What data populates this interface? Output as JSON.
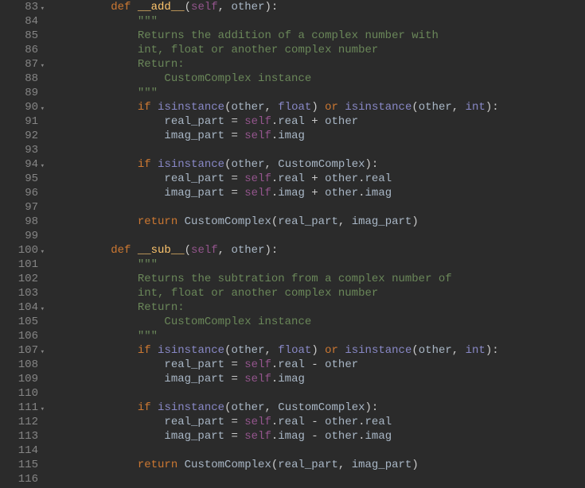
{
  "gutter": {
    "start": 83,
    "end": 116,
    "fold_lines": [
      83,
      87,
      90,
      94,
      100,
      104,
      107,
      111
    ]
  },
  "code": {
    "lines": [
      {
        "t": "def1",
        "indent": 8,
        "name": "__add__",
        "params": "(self, other):"
      },
      {
        "t": "doc",
        "indent": 12,
        "text": "\"\"\""
      },
      {
        "t": "doc",
        "indent": 12,
        "text": "Returns the addition of a complex number with"
      },
      {
        "t": "doc",
        "indent": 12,
        "text": "int, float or another complex number"
      },
      {
        "t": "doc",
        "indent": 12,
        "text": "Return:"
      },
      {
        "t": "doc",
        "indent": 12,
        "text": "    CustomComplex instance"
      },
      {
        "t": "doc",
        "indent": 12,
        "text": "\"\"\""
      },
      {
        "t": "if1",
        "indent": 12
      },
      {
        "t": "assign",
        "indent": 16,
        "lhs": "real_part",
        "rhs_self": "real",
        "op": "+",
        "tail": "other"
      },
      {
        "t": "assign",
        "indent": 16,
        "lhs": "imag_part",
        "rhs_self": "imag",
        "op": "",
        "tail": ""
      },
      {
        "t": "blank"
      },
      {
        "t": "if2",
        "indent": 12
      },
      {
        "t": "assign",
        "indent": 16,
        "lhs": "real_part",
        "rhs_self": "real",
        "op": "+",
        "tail": "other.real"
      },
      {
        "t": "assign",
        "indent": 16,
        "lhs": "imag_part",
        "rhs_self": "imag",
        "op": "+",
        "tail": "other.imag"
      },
      {
        "t": "blank"
      },
      {
        "t": "ret",
        "indent": 12
      },
      {
        "t": "blank"
      },
      {
        "t": "def1",
        "indent": 8,
        "name": "__sub__",
        "params": "(self, other):"
      },
      {
        "t": "doc",
        "indent": 12,
        "text": "\"\"\""
      },
      {
        "t": "doc",
        "indent": 12,
        "text": "Returns the subtration from a complex number of"
      },
      {
        "t": "doc",
        "indent": 12,
        "text": "int, float or another complex number"
      },
      {
        "t": "doc",
        "indent": 12,
        "text": "Return:"
      },
      {
        "t": "doc",
        "indent": 12,
        "text": "    CustomComplex instance"
      },
      {
        "t": "doc",
        "indent": 12,
        "text": "\"\"\""
      },
      {
        "t": "if1",
        "indent": 12
      },
      {
        "t": "assign",
        "indent": 16,
        "lhs": "real_part",
        "rhs_self": "real",
        "op": "-",
        "tail": "other"
      },
      {
        "t": "assign",
        "indent": 16,
        "lhs": "imag_part",
        "rhs_self": "imag",
        "op": "",
        "tail": ""
      },
      {
        "t": "blank"
      },
      {
        "t": "if2",
        "indent": 12
      },
      {
        "t": "assign",
        "indent": 16,
        "lhs": "real_part",
        "rhs_self": "real",
        "op": "-",
        "tail": "other.real"
      },
      {
        "t": "assign",
        "indent": 16,
        "lhs": "imag_part",
        "rhs_self": "imag",
        "op": "-",
        "tail": "other.imag"
      },
      {
        "t": "blank"
      },
      {
        "t": "ret",
        "indent": 12
      },
      {
        "t": "blank"
      }
    ]
  },
  "tokens": {
    "def": "def",
    "if": "if",
    "or": "or",
    "return": "return",
    "isinstance": "isinstance",
    "float": "float",
    "int": "int",
    "self": "self",
    "CustomComplex": "CustomComplex",
    "real_part": "real_part",
    "imag_part": "imag_part"
  }
}
